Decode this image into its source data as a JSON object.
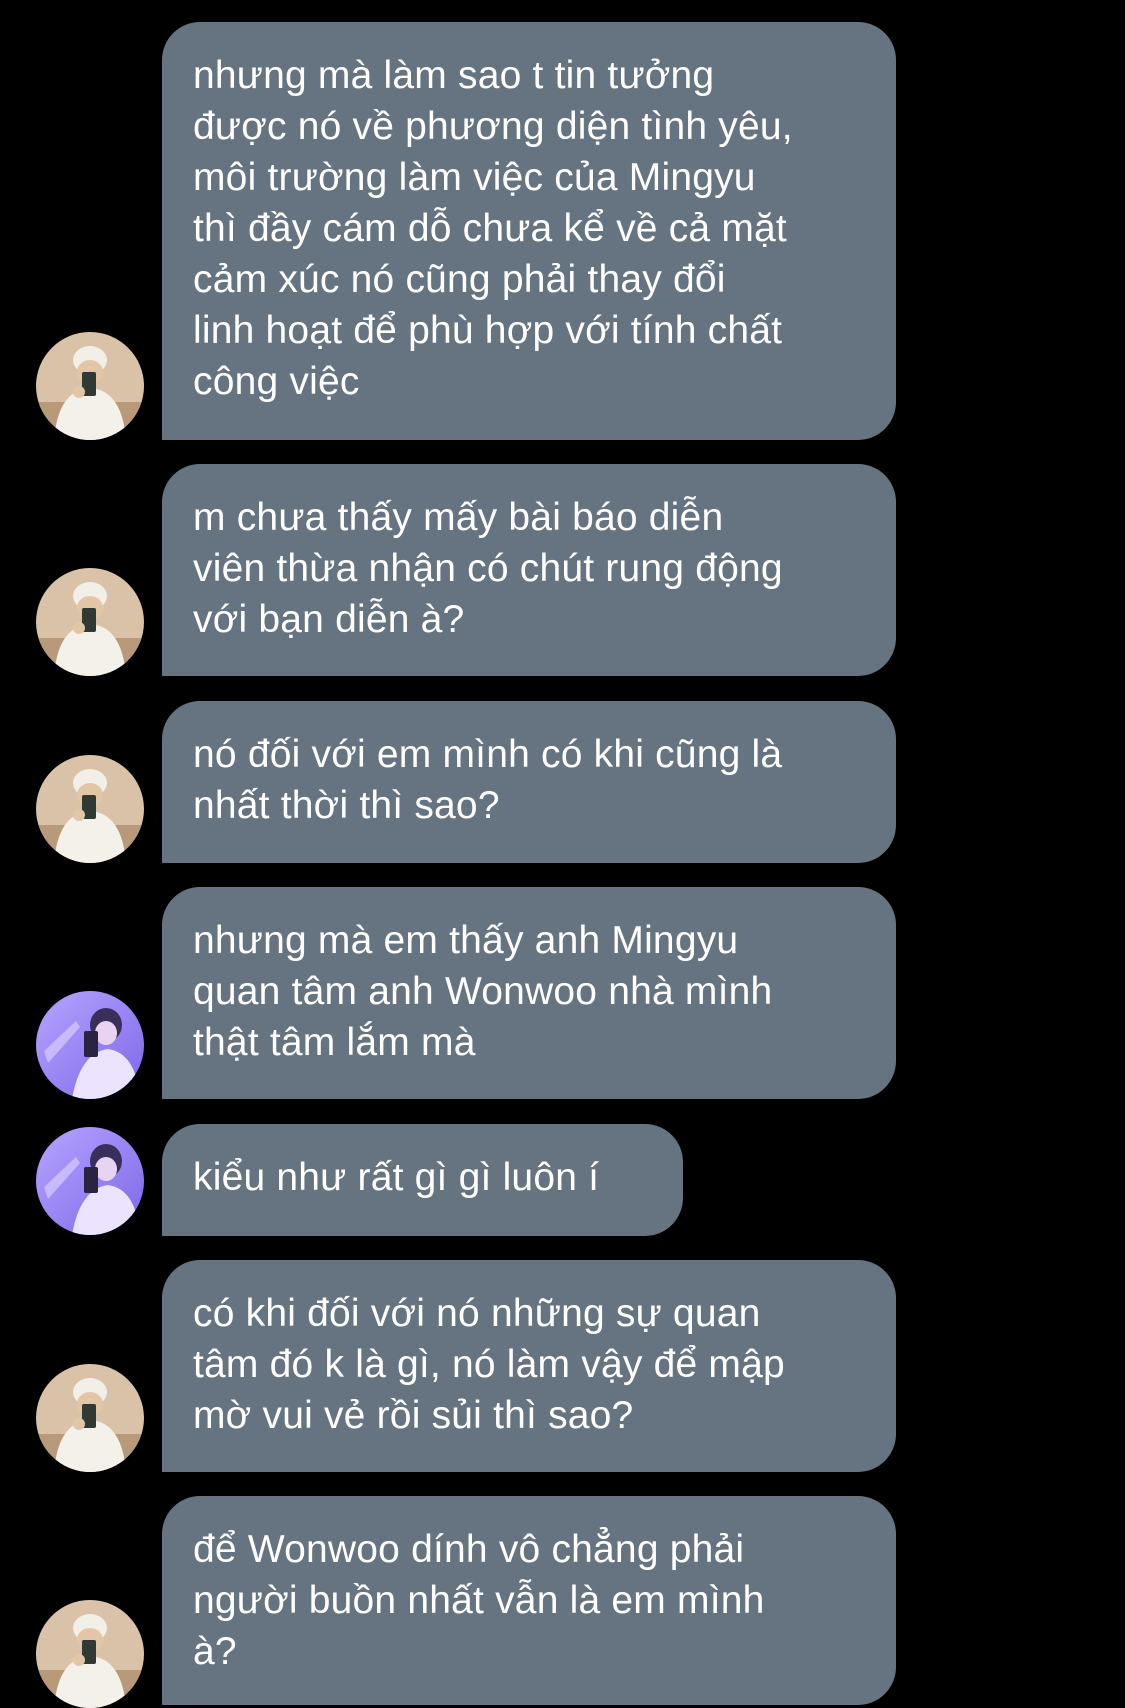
{
  "chat": {
    "messages": [
      {
        "sender": "avatar-a",
        "text": "nhưng mà làm sao t tin tưởng\nđược nó về phương diện tình yêu,\nmôi trường làm việc của Mingyu\nthì đầy cám dỗ chưa kể về cả mặt\ncảm xúc nó cũng phải thay đổi\nlinh hoạt để phù hợp với tính chất\ncông việc"
      },
      {
        "sender": "avatar-a",
        "text": "m chưa thấy mấy bài báo diễn\nviên thừa nhận có chút rung động\nvới bạn diễn à?"
      },
      {
        "sender": "avatar-a",
        "text": "nó đối với em mình có khi cũng là\nnhất thời thì sao?"
      },
      {
        "sender": "avatar-b",
        "text": "nhưng mà em thấy anh Mingyu\nquan tâm anh Wonwoo nhà mình\nthật tâm lắm mà"
      },
      {
        "sender": "avatar-b",
        "text": "kiểu như rất gì gì luôn í"
      },
      {
        "sender": "avatar-a",
        "text": "có khi đối với nó những sự quan\ntâm đó k là gì, nó làm vậy để mập\nmờ vui vẻ rồi sủi thì sao?"
      },
      {
        "sender": "avatar-a",
        "text": "để Wonwoo dính vô chẳng phải\nngười buồn nhất vẫn là em mình\nà?"
      }
    ]
  },
  "theme": {
    "background": "#000000",
    "bubble_color": "#667380",
    "text_color": "#ffffff"
  }
}
